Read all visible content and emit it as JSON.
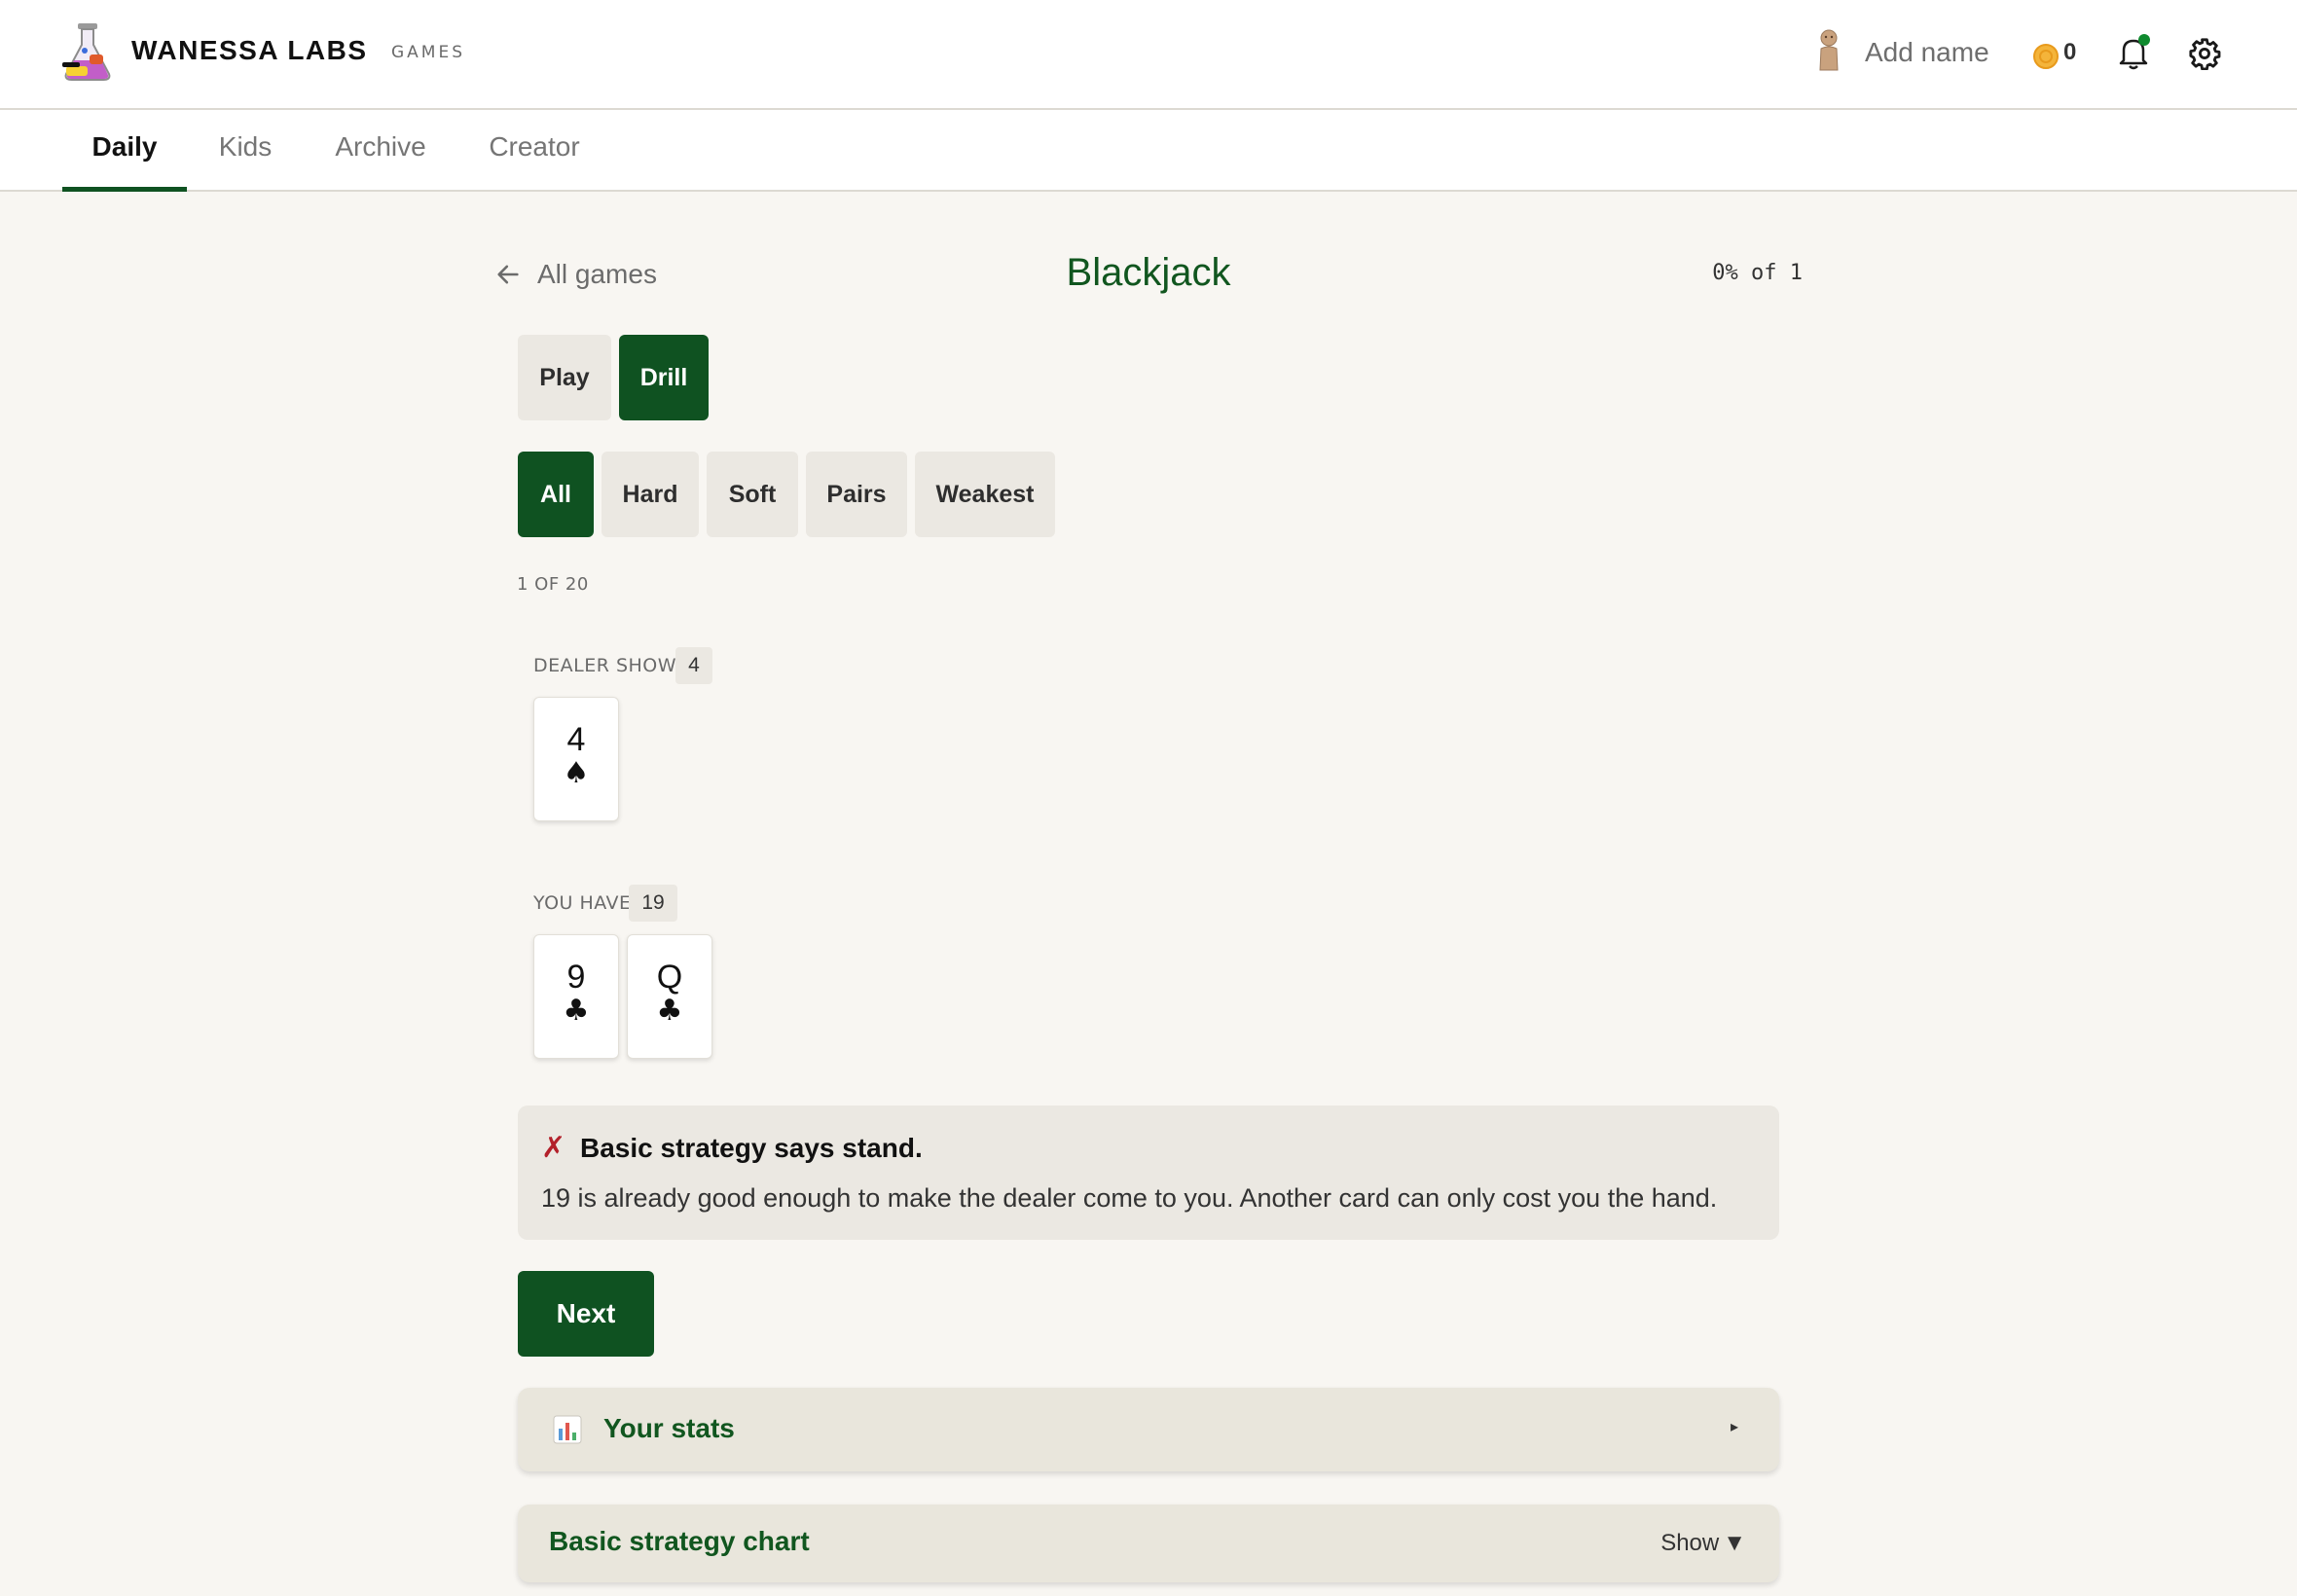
{
  "header": {
    "brand": "WANESSA LABS",
    "brand_sub": "GAMES",
    "add_name": "Add name",
    "coins": "0"
  },
  "tabs": [
    {
      "label": "Daily",
      "active": true
    },
    {
      "label": "Kids",
      "active": false
    },
    {
      "label": "Archive",
      "active": false
    },
    {
      "label": "Creator",
      "active": false
    }
  ],
  "page": {
    "back_label": "All games",
    "title": "Blackjack",
    "progress": "0% of 1"
  },
  "mode": {
    "play": "Play",
    "drill": "Drill",
    "selected": "Drill"
  },
  "filters": {
    "all": "All",
    "hard": "Hard",
    "soft": "Soft",
    "pairs": "Pairs",
    "weakest": "Weakest",
    "selected": "All"
  },
  "counter": "1 OF 20",
  "dealer": {
    "label": "DEALER SHOWS",
    "total": "4",
    "cards": [
      {
        "rank": "4",
        "suit": "♠"
      }
    ]
  },
  "player": {
    "label": "YOU HAVE",
    "total": "19",
    "cards": [
      {
        "rank": "9",
        "suit": "♣"
      },
      {
        "rank": "Q",
        "suit": "♣"
      }
    ]
  },
  "feedback": {
    "mark": "✗",
    "title": "Basic strategy says stand.",
    "text": "19 is already good enough to make the dealer come to you. Another card can only cost you the hand."
  },
  "next_label": "Next",
  "stats_panel": {
    "title": "Your stats",
    "caret": "▸"
  },
  "chart_panel": {
    "title": "Basic strategy chart",
    "toggle": "Show",
    "toggle_icon": "▼"
  },
  "colors": {
    "accent": "#0f5221",
    "background": "#f8f6f2",
    "error": "#b3202a"
  }
}
